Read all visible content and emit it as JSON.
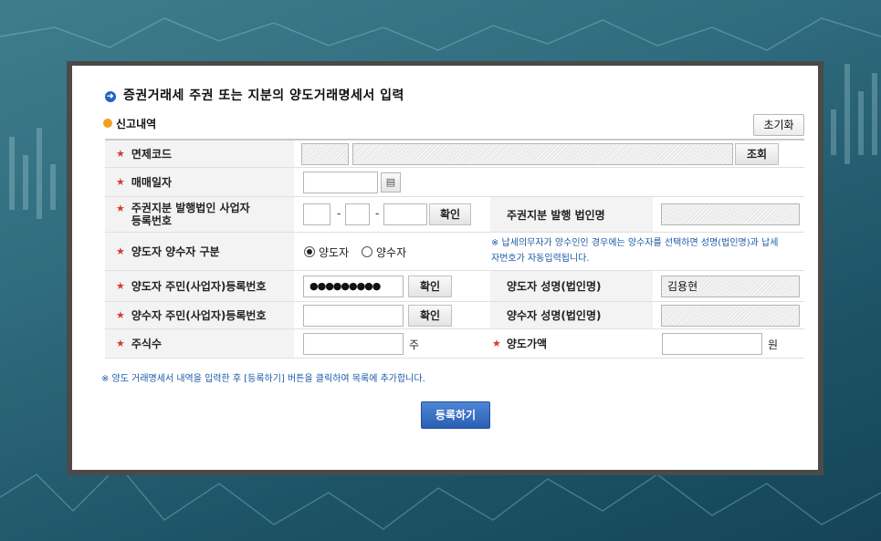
{
  "page": {
    "title": "증권거래세 주권 또는 지분의 양도거래명세서 입력",
    "section_title": "신고내역",
    "reset_label": "초기화"
  },
  "form": {
    "exemption_code": {
      "label": "면제코드",
      "lookup_label": "조회"
    },
    "trade_date": {
      "label": "매매일자",
      "value": ""
    },
    "issuer_brn": {
      "label": "주권지분 발행법인 사업자등록번호",
      "check_label": "확인",
      "name_label": "주권지분 발행 법인명",
      "name_value": ""
    },
    "party_type": {
      "label": "양도자 양수자 구분",
      "options": [
        "양도자",
        "양수자"
      ],
      "selected": "양도자",
      "note": "※ 납세의무자가 양수인인 경우에는 양수자를 선택하면 성명(법인명)과 납세자번호가 자동입력됩니다."
    },
    "transferor": {
      "label": "양도자 주민(사업자)등록번호",
      "value": "●●●●●●●●●",
      "check_label": "확인",
      "name_label": "양도자 성명(법인명)",
      "name_value": "김용현"
    },
    "transferee": {
      "label": "양수자 주민(사업자)등록번호",
      "value": "",
      "check_label": "확인",
      "name_label": "양수자 성명(법인명)",
      "name_value": ""
    },
    "shares": {
      "label": "주식수",
      "value": "",
      "unit": "주",
      "price_label": "양도가액",
      "price_value": "",
      "price_unit": "원"
    }
  },
  "footer": {
    "note": "※ 양도 거래명세서 내역을 입력한 후 [등록하기] 버튼을 클릭하여 목록에 추가합니다.",
    "submit_label": "등록하기"
  },
  "icons": {
    "title": "arrow-circle-icon",
    "section": "bullet-icon",
    "calendar": "calendar-icon"
  },
  "colors": {
    "accent": "#2a5fb4",
    "required": "#d63b2e",
    "note": "#1a5aa8"
  }
}
